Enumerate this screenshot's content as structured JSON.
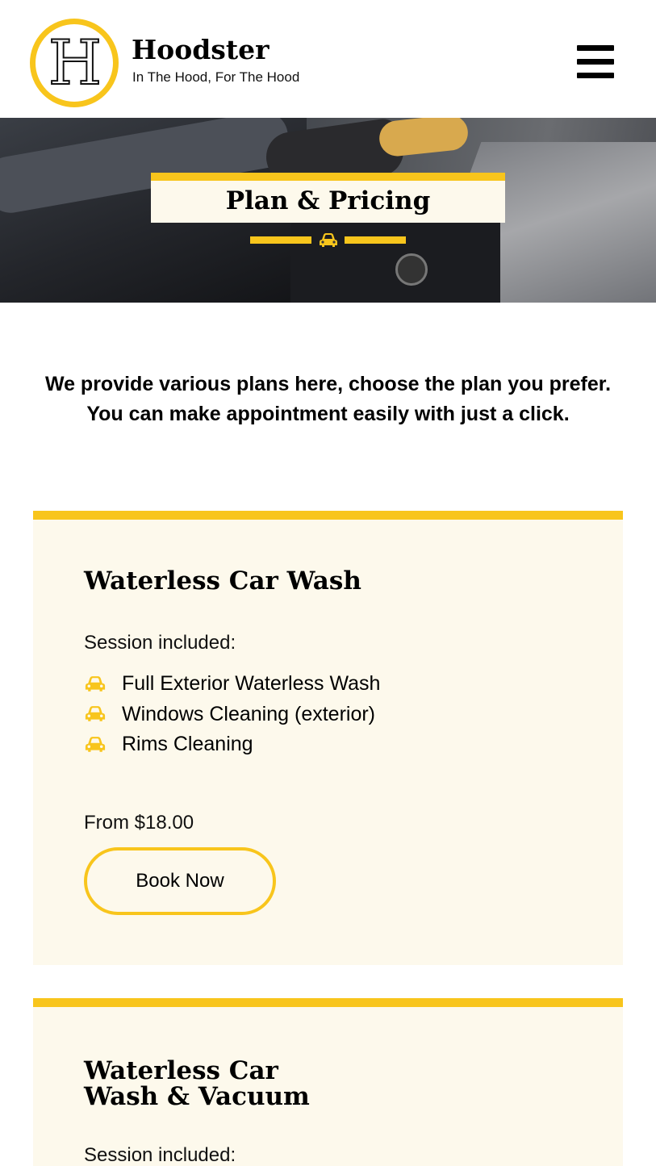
{
  "header": {
    "logo_letter": "H",
    "brand_name": "Hoodster",
    "tagline": "In The Hood, For The Hood",
    "menu_icon": "hamburger-menu-icon"
  },
  "hero": {
    "title": "Plan & Pricing",
    "divider_icon": "car-icon"
  },
  "intro": {
    "line1": "We provide various plans here, choose the plan you prefer.",
    "line2": "You can make appointment easily with just a click."
  },
  "plans": [
    {
      "title": "Waterless Car Wash",
      "session_label": "Session included:",
      "features": [
        "Full Exterior Waterless Wash",
        "Windows Cleaning (exterior)",
        "Rims Cleaning"
      ],
      "price": "From $18.00",
      "button_label": "Book Now"
    },
    {
      "title": "Waterless Car Wash & Vacuum",
      "session_label": "Session included:"
    }
  ],
  "colors": {
    "accent": "#f8c51c",
    "card_bg": "#fdf9ec",
    "text": "#000000"
  }
}
